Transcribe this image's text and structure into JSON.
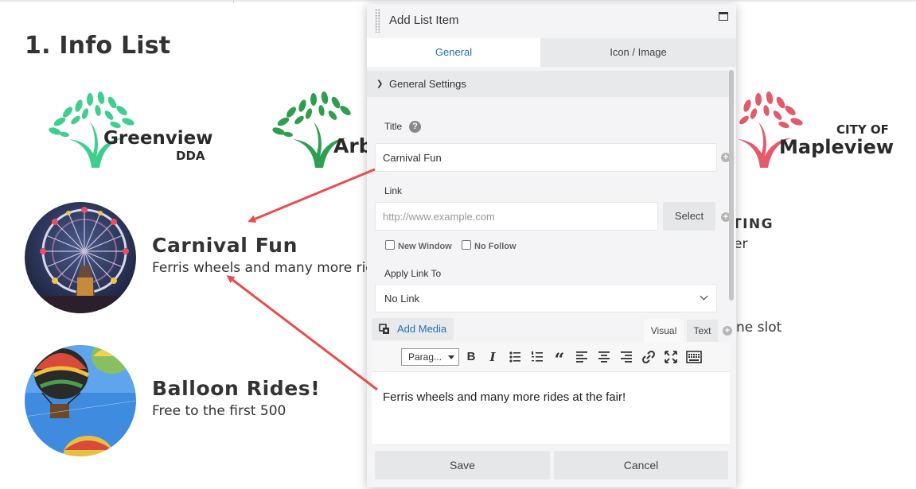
{
  "page": {
    "section_title": "1. Info List",
    "logos": [
      {
        "main": "Greenview",
        "sub": "DDA",
        "color": "#3ecf8e"
      },
      {
        "main": "Arb",
        "color": "#2e9e4f"
      },
      {
        "main": "Mapleview",
        "sub": "CITY OF",
        "color": "#e35b6a"
      }
    ],
    "list_items": [
      {
        "title": "Carnival Fun",
        "description": "Ferris wheels and many more rides at the fair!"
      },
      {
        "title": "Balloon Rides!",
        "description": "Free to the first 500"
      }
    ],
    "partial_right": {
      "heading_fragment": "TING",
      "line1_fragment": "er",
      "line2_fragment": "ne slot"
    }
  },
  "modal": {
    "title": "Add List Item",
    "maximize_icon": "window-maximize-icon",
    "tabs": [
      {
        "label": "General",
        "active": true
      },
      {
        "label": "Icon / Image",
        "active": false
      }
    ],
    "section_label": "General Settings",
    "title_field": {
      "label": "Title",
      "value": "Carnival Fun"
    },
    "link_field": {
      "label": "Link",
      "placeholder": "http://www.example.com",
      "select_label": "Select"
    },
    "checkboxes": [
      {
        "label": "New Window",
        "checked": false
      },
      {
        "label": "No Follow",
        "checked": false
      }
    ],
    "apply_link_to": {
      "label": "Apply Link To",
      "value": "No Link"
    },
    "editor": {
      "add_media_label": "Add Media",
      "tabs": [
        {
          "label": "Visual",
          "active": true
        },
        {
          "label": "Text",
          "active": false
        }
      ],
      "paragraph_select": "Parag...",
      "toolbar_icons": [
        "bold-icon",
        "italic-icon",
        "bullet-list-icon",
        "numbered-list-icon",
        "blockquote-icon",
        "align-left-icon",
        "align-center-icon",
        "align-right-icon",
        "link-icon",
        "fullscreen-icon",
        "toolbar-toggle-icon"
      ],
      "content": "Ferris wheels and many more rides at the fair!"
    },
    "footer": {
      "save_label": "Save",
      "cancel_label": "Cancel"
    }
  },
  "colors": {
    "link_blue": "#2271b1",
    "arrow_red": "#ea4c4c"
  }
}
